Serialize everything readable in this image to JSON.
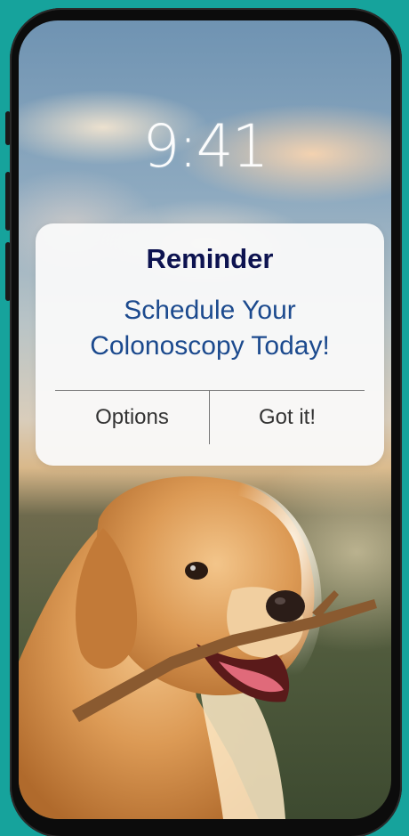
{
  "lock_screen": {
    "time": "9:41"
  },
  "notification": {
    "title": "Reminder",
    "message_lines": [
      "Schedule Your",
      "Colonoscopy Today!"
    ],
    "actions": {
      "options_label": "Options",
      "got_it_label": "Got it!"
    }
  },
  "wallpaper": {
    "subject": "dog-photo"
  },
  "colors": {
    "background": "#16a39c",
    "title": "#0d1350",
    "message": "#1c4a8e",
    "action_text": "#333333"
  }
}
